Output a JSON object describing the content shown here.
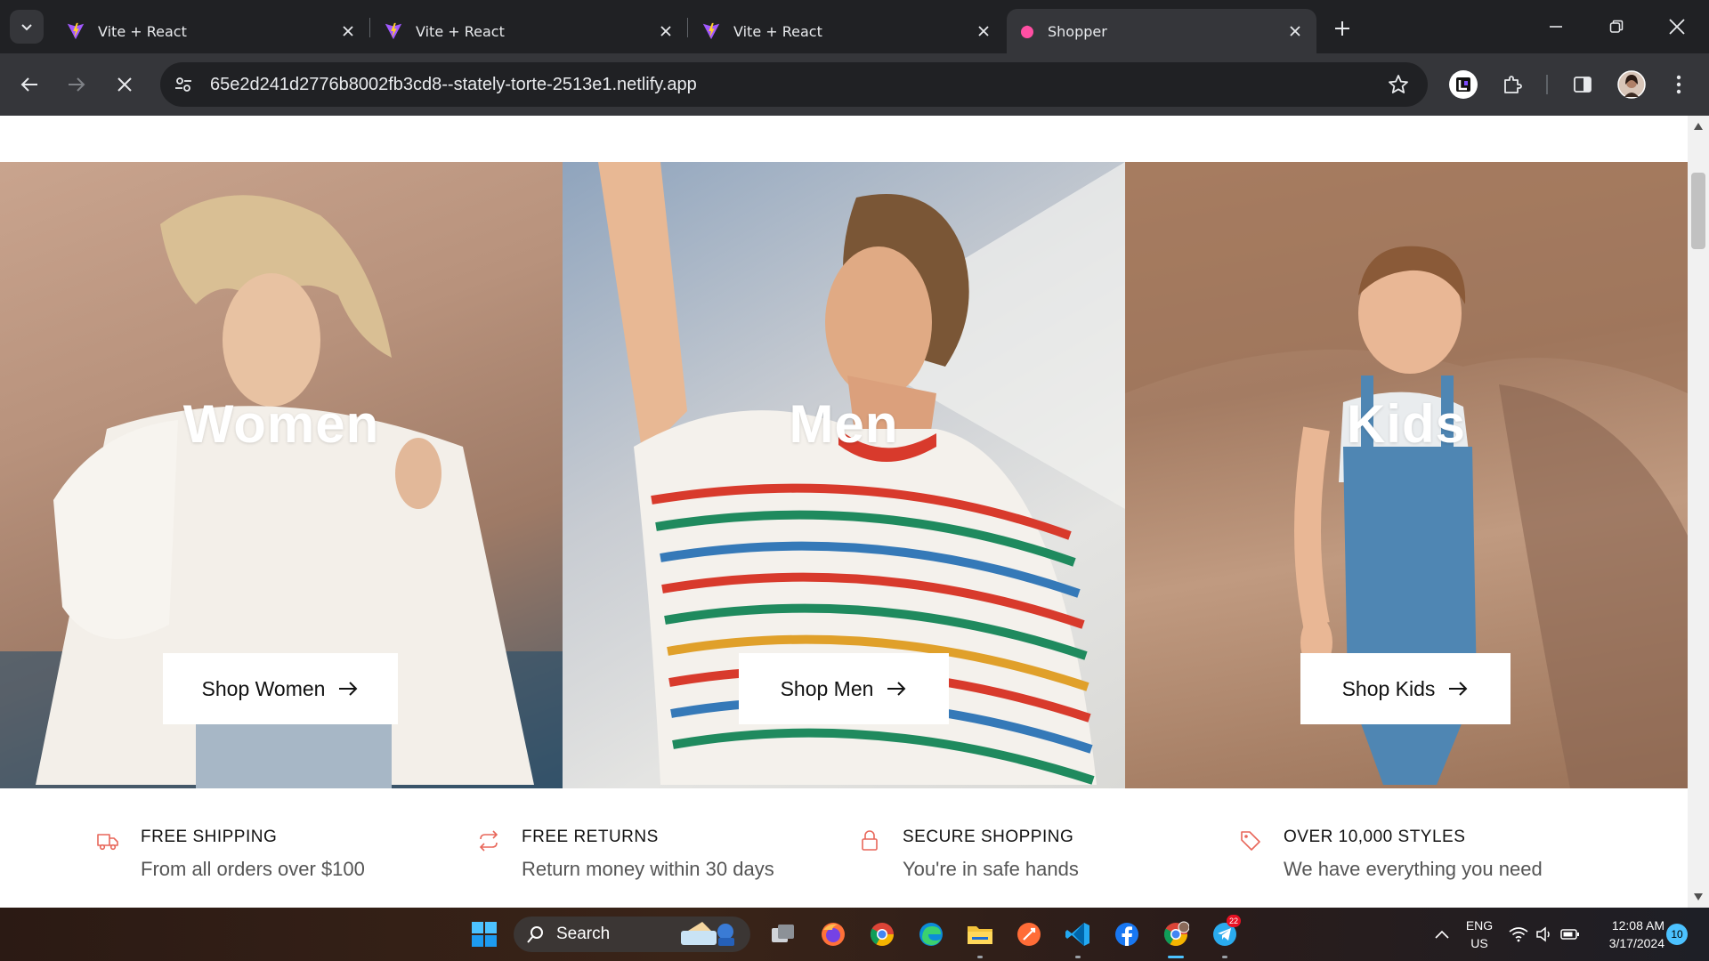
{
  "browser": {
    "tabs": [
      {
        "title": "Vite + React",
        "favicon": "vite-icon",
        "active": false
      },
      {
        "title": "Vite + React",
        "favicon": "vite-icon",
        "active": false
      },
      {
        "title": "Vite + React",
        "favicon": "vite-icon",
        "active": false
      },
      {
        "title": "Shopper",
        "favicon": "shopper-icon",
        "active": true
      }
    ],
    "url": "65e2d241d2776b8002fb3cd8--stately-torte-2513e1.netlify.app",
    "loading": true
  },
  "page": {
    "categories": [
      {
        "title": "Women",
        "button_label": "Shop Women"
      },
      {
        "title": "Men",
        "button_label": "Shop Men"
      },
      {
        "title": "Kids",
        "button_label": "Shop Kids"
      }
    ],
    "features": [
      {
        "icon": "truck-icon",
        "title": "FREE SHIPPING",
        "description": "From all orders over $100"
      },
      {
        "icon": "returns-icon",
        "title": "FREE RETURNS",
        "description": "Return money within 30 days"
      },
      {
        "icon": "lock-icon",
        "title": "SECURE SHOPPING",
        "description": "You're in safe hands"
      },
      {
        "icon": "tag-icon",
        "title": "OVER 10,000 STYLES",
        "description": "We have everything you need"
      }
    ],
    "accent_color": "#e8675a"
  },
  "taskbar": {
    "search_label": "Search",
    "language": "ENG",
    "region": "US",
    "time": "12:08 AM",
    "date": "3/17/2024",
    "notifications": "10",
    "telegram_badge": "22"
  }
}
